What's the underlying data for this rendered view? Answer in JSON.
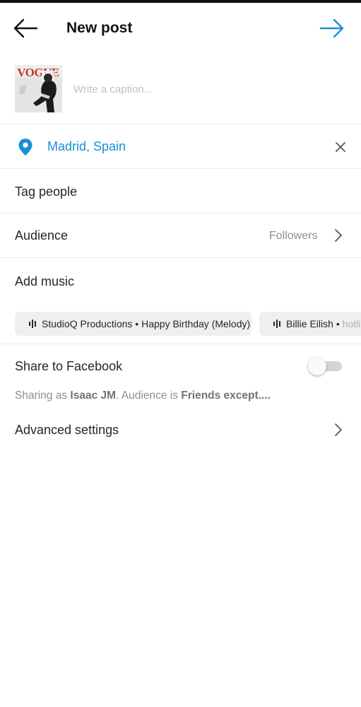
{
  "header": {
    "title": "New post"
  },
  "caption": {
    "placeholder": "Write a caption...",
    "thumbnail_text": "VOGUE"
  },
  "location": {
    "name": "Madrid, Spain"
  },
  "rows": {
    "tag_people": "Tag people",
    "audience_label": "Audience",
    "audience_value": "Followers",
    "add_music": "Add music",
    "advanced_settings": "Advanced settings"
  },
  "music_suggestions": [
    {
      "artist": "StudioQ Productions",
      "separator": "•",
      "title": "Happy Birthday (Melody)"
    },
    {
      "artist": "Billie Eilish",
      "separator": "•",
      "title": "hotline bling"
    }
  ],
  "facebook": {
    "label": "Share to Facebook",
    "enabled": false,
    "sharing_prefix": "Sharing as ",
    "sharing_name": "Isaac JM",
    "sharing_middle": ". Audience is ",
    "sharing_audience": "Friends except...",
    "sharing_suffix": "."
  },
  "colors": {
    "accent": "#1a8fd8",
    "secondary_text": "#8e8e8e",
    "divider": "#ececec"
  },
  "icons": {
    "back": "arrow-left-icon",
    "next": "arrow-right-icon",
    "location": "location-pin-icon",
    "clear": "close-icon",
    "chevron": "chevron-right-icon",
    "music": "audio-bars-icon"
  }
}
